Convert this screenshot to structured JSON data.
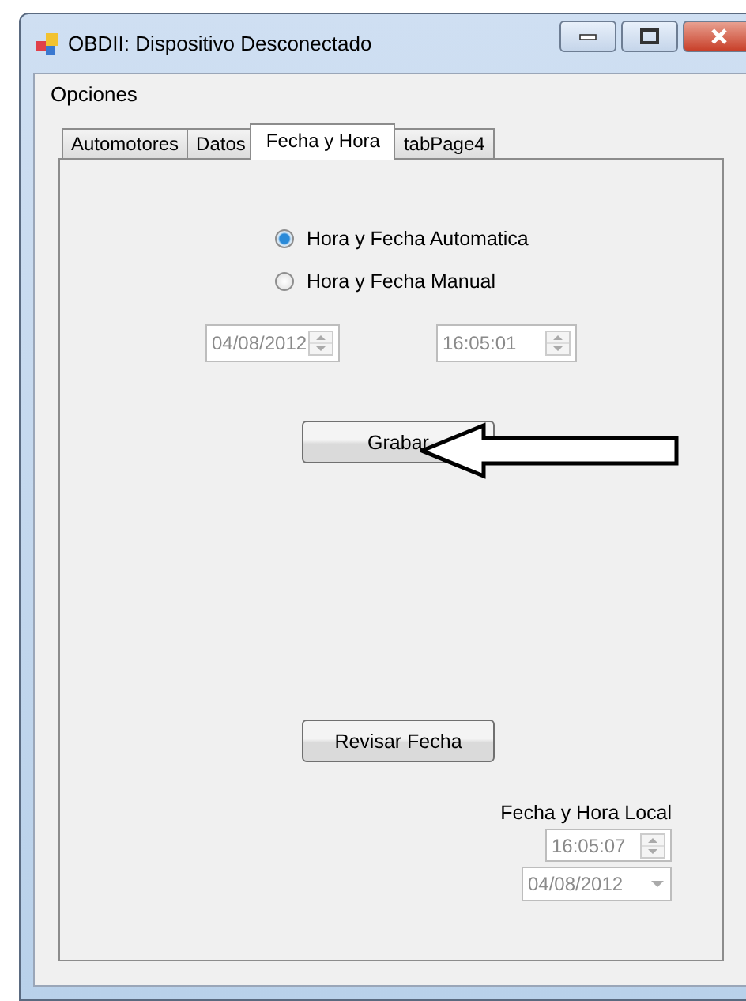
{
  "window": {
    "title": "OBDII: Dispositivo Desconectado"
  },
  "menu": [
    {
      "label": "Opciones"
    }
  ],
  "tabs": [
    {
      "label": "Automotores",
      "selected": false
    },
    {
      "label": "Datos",
      "selected": false
    },
    {
      "label": "Fecha y Hora",
      "selected": true
    },
    {
      "label": "tabPage4",
      "selected": false
    }
  ],
  "mode_options": [
    {
      "label": "Hora y Fecha Automatica",
      "selected": true
    },
    {
      "label": "Hora y Fecha Manual",
      "selected": false
    }
  ],
  "manual_date": {
    "value": "04/08/2012",
    "disabled": true
  },
  "manual_time": {
    "value": "16:05:01",
    "disabled": true
  },
  "save_button": {
    "label": "Grabar"
  },
  "check_button": {
    "label": "Revisar Fecha"
  },
  "local": {
    "label": "Fecha y Hora Local",
    "time": {
      "value": "16:05:07",
      "disabled": true
    },
    "date": {
      "value": "04/08/2012",
      "disabled": true
    }
  }
}
